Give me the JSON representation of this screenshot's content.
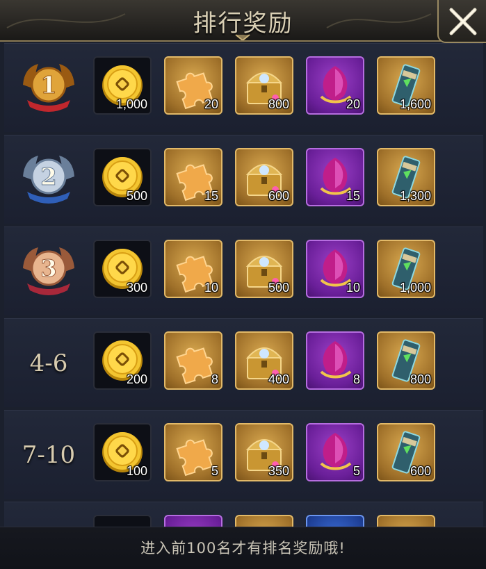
{
  "header": {
    "title": "排行奖励"
  },
  "icons": {
    "close": "close-x-icon",
    "coin": "gold-coin-icon",
    "puzzle": "puzzle-piece-icon",
    "chest": "treasure-chest-icon",
    "gem": "purple-gem-icon",
    "scroll": "scroll-ticket-icon"
  },
  "colors": {
    "gold_frame": "#e2b968",
    "purple_frame": "#b66de0",
    "title_text": "#d9cfb4"
  },
  "rows": [
    {
      "rank": "1",
      "rank_badge": "gold-medal-icon",
      "items": [
        {
          "icon": "coin",
          "qty": "1,000"
        },
        {
          "icon": "puzzle",
          "qty": "20"
        },
        {
          "icon": "chest",
          "qty": "800"
        },
        {
          "icon": "gem",
          "qty": "20"
        },
        {
          "icon": "scroll",
          "qty": "1,600"
        }
      ]
    },
    {
      "rank": "2",
      "rank_badge": "silver-medal-icon",
      "items": [
        {
          "icon": "coin",
          "qty": "500"
        },
        {
          "icon": "puzzle",
          "qty": "15"
        },
        {
          "icon": "chest",
          "qty": "600"
        },
        {
          "icon": "gem",
          "qty": "15"
        },
        {
          "icon": "scroll",
          "qty": "1,300"
        }
      ]
    },
    {
      "rank": "3",
      "rank_badge": "bronze-medal-icon",
      "items": [
        {
          "icon": "coin",
          "qty": "300"
        },
        {
          "icon": "puzzle",
          "qty": "10"
        },
        {
          "icon": "chest",
          "qty": "500"
        },
        {
          "icon": "gem",
          "qty": "10"
        },
        {
          "icon": "scroll",
          "qty": "1,000"
        }
      ]
    },
    {
      "rank": "4-6",
      "items": [
        {
          "icon": "coin",
          "qty": "200"
        },
        {
          "icon": "puzzle",
          "qty": "8"
        },
        {
          "icon": "chest",
          "qty": "400"
        },
        {
          "icon": "gem",
          "qty": "8"
        },
        {
          "icon": "scroll",
          "qty": "800"
        }
      ]
    },
    {
      "rank": "7-10",
      "items": [
        {
          "icon": "coin",
          "qty": "100"
        },
        {
          "icon": "puzzle",
          "qty": "5"
        },
        {
          "icon": "chest",
          "qty": "350"
        },
        {
          "icon": "gem",
          "qty": "5"
        },
        {
          "icon": "scroll",
          "qty": "600"
        }
      ]
    }
  ],
  "partial_row_item_frames": [
    "dark",
    "purple",
    "gold",
    "blue",
    "gold"
  ],
  "footer": {
    "notice": "进入前100名才有排名奖励哦!"
  }
}
